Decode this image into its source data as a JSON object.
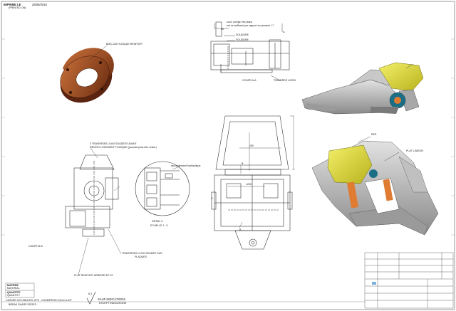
{
  "header": {
    "printed_label": "IMPRIME LE",
    "printed_sub": "(PRINTED ON)",
    "date": "28/09/2010"
  },
  "annotations": {
    "ring": "BMS-125 FLASQUE RENFORT",
    "note1": "cout; corriger les plans",
    "note2": "est ce suffisant par rapport au pressoir ??",
    "weld1": "SOUDURE",
    "weld2": "SOUDURE",
    "section_aa": "COUPE A-A",
    "traverse_u220": "TRAVERSE  UC220",
    "traverses_avant": "3 TRAVERSES U 640 SOUDEES AVANT",
    "renvoi": "RENVOI LOGEMENT FLASQUE (pourrait peut-etre rester)",
    "hydraulic": "raccordement hydraulique",
    "detail_c": "DETAIL C",
    "scale_c": "ECHELLE 1 : 5",
    "section_bb": "COUPE B-B",
    "traverses_u220": "TRAVERSES U 220 SOUDEE SUR",
    "plaques": "PLAQUES",
    "plat_arriere": "PLAT RENFORT ARRIERE EP 15",
    "res": "RES",
    "plat_liaison": "PLAT LIAISON",
    "dim_290": "290",
    "dim_1200": "1200",
    "dim_50": "50",
    "sec_b_top": "B",
    "sec_b_bottom": "B",
    "detail_mark": "C",
    "mark_a": "A"
  },
  "title_block": {
    "matiere_label": "MATIERE",
    "matiere_sub": "MATERIAL",
    "quantite_label": "QUANTITE",
    "quantite_sub": "QUANTITY",
    "note_casser": "CASSER LES ANGLES VIFS - CHAMFREIN 0,5mm à 45°",
    "note_casser_sub": "BREAK SHARP EDGES",
    "sauf": "SAUF INDICATIONS",
    "sauf_sub": "EXCEPT INDICATIONS",
    "symbol_val": "6,3"
  }
}
